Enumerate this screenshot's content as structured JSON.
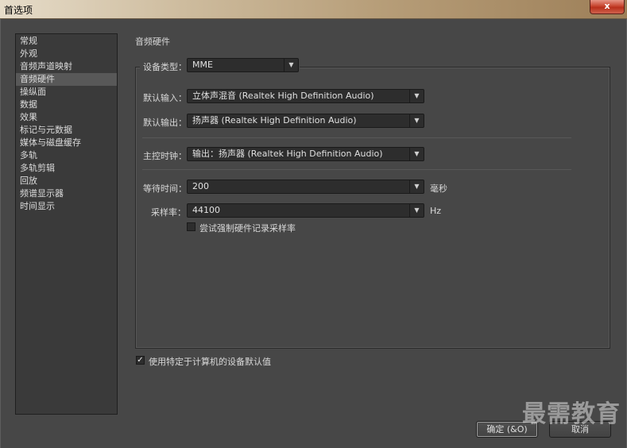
{
  "window": {
    "title": "首选项",
    "close_label": "x"
  },
  "sidebar": {
    "items": [
      {
        "label": "常规"
      },
      {
        "label": "外观"
      },
      {
        "label": "音频声道映射"
      },
      {
        "label": "音频硬件",
        "selected": true
      },
      {
        "label": "操纵面"
      },
      {
        "label": "数据"
      },
      {
        "label": "效果"
      },
      {
        "label": "标记与元数据"
      },
      {
        "label": "媒体与磁盘缓存"
      },
      {
        "label": "多轨"
      },
      {
        "label": "多轨剪辑"
      },
      {
        "label": "回放"
      },
      {
        "label": "频谱显示器"
      },
      {
        "label": "时间显示"
      }
    ]
  },
  "section": {
    "title": "音频硬件"
  },
  "device_type": {
    "label": "设备类型：",
    "value": "MME"
  },
  "default_input": {
    "label": "默认输入：",
    "value": "立体声混音 (Realtek High Definition Audio)"
  },
  "default_output": {
    "label": "默认输出：",
    "value": "扬声器 (Realtek High Definition Audio)"
  },
  "master_clock": {
    "label": "主控时钟：",
    "value": "输出：扬声器 (Realtek High Definition Audio)"
  },
  "latency": {
    "label": "等待时间：",
    "value": "200",
    "unit": "毫秒"
  },
  "sample_rate": {
    "label": "采样率：",
    "value": "44100",
    "unit": "Hz"
  },
  "force_rate": {
    "label": "尝试强制硬件记录采样率",
    "checked": false
  },
  "use_defaults": {
    "label": "使用特定于计算机的设备默认值",
    "checked": true
  },
  "buttons": {
    "ok": "确定 (&O)",
    "cancel": "取消"
  },
  "watermark": "最需教育",
  "icons": {
    "dropdown": "chevron-down-icon",
    "check": "checkmark-icon"
  }
}
